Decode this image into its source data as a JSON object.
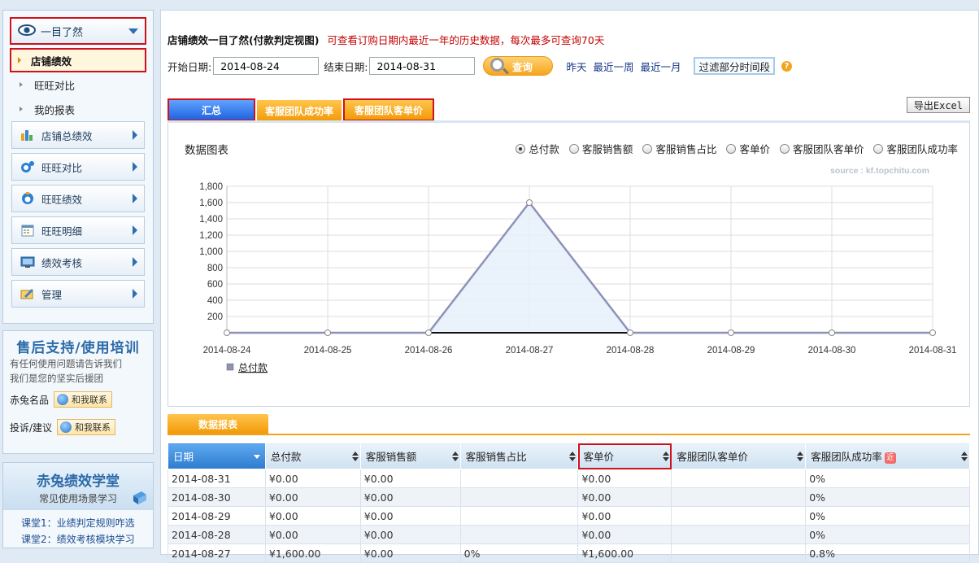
{
  "sidebar": {
    "top_label": "一目了然",
    "active_item": "店铺绩效",
    "subitems": [
      "旺旺对比",
      "我的报表"
    ],
    "menu": [
      {
        "label": "店铺总绩效",
        "icon": "bar-chart-icon"
      },
      {
        "label": "旺旺对比",
        "icon": "wangwang-compare-icon"
      },
      {
        "label": "旺旺绩效",
        "icon": "wangwang-icon"
      },
      {
        "label": "旺旺明细",
        "icon": "calendar-detail-icon"
      },
      {
        "label": "绩效考核",
        "icon": "monitor-icon"
      },
      {
        "label": "管理",
        "icon": "manage-icon"
      }
    ]
  },
  "support": {
    "title": "售后支持/使用培训",
    "line1": "有任何使用问题请告诉我们",
    "line2": "我们是您的坚实后援团",
    "contacts": [
      {
        "label": "赤兔名品",
        "button": "和我联系"
      },
      {
        "label": "投诉/建议",
        "button": "和我联系"
      }
    ]
  },
  "learn": {
    "title": "赤兔绩效学堂",
    "subtitle": "常见使用场景学习",
    "links": [
      "课堂1：业绩判定规则咋选",
      "课堂2：绩效考核模块学习"
    ]
  },
  "header": {
    "title": "店铺绩效一目了然(付款判定视图)",
    "hint": "可查看订购日期内最近一年的历史数据，每次最多可查询70天"
  },
  "filters": {
    "start_label": "开始日期:",
    "start_value": "2014-08-24",
    "end_label": "结束日期:",
    "end_value": "2014-08-31",
    "query_label": "查询",
    "quick": [
      "昨天",
      "最近一周",
      "最近一月"
    ],
    "filter_label": "过滤部分时间段"
  },
  "tabs": [
    {
      "label": "汇总",
      "width": 108
    },
    {
      "label": "客服团队成功率",
      "width": 104
    },
    {
      "label": "客服团队客单价",
      "width": 112
    }
  ],
  "export_label": "导出Excel",
  "chart_panel": {
    "title": "数据图表",
    "radios": [
      "总付款",
      "客服销售额",
      "客服销售占比",
      "客单价",
      "客服团队客单价",
      "客服团队成功率"
    ],
    "selected": "总付款",
    "source": "source : kf.topchitu.com"
  },
  "chart_data": {
    "type": "area",
    "x": [
      "2014-08-24",
      "2014-08-25",
      "2014-08-26",
      "2014-08-27",
      "2014-08-28",
      "2014-08-29",
      "2014-08-30",
      "2014-08-31"
    ],
    "series": [
      {
        "name": "总付款",
        "values": [
          0,
          0,
          0,
          1600,
          0,
          0,
          0,
          0
        ]
      }
    ],
    "ylim": [
      0,
      1800
    ],
    "yticks": [
      "200",
      "400",
      "600",
      "800",
      "1,000",
      "1,200",
      "1,400",
      "1,600",
      "1,800"
    ],
    "grid": true,
    "legend_position": "bottom-left",
    "colors": {
      "line": "#8e92b8",
      "fill": "#e6f1fa",
      "grid": "#dddddd"
    }
  },
  "report_label": "数据报表",
  "table": {
    "columns": [
      "日期",
      "总付款",
      "客服销售额",
      "客服销售占比",
      "客单价",
      "客服团队客单价",
      "客服团队成功率"
    ],
    "badge": "近",
    "rows": [
      [
        "2014-08-31",
        "¥0.00",
        "¥0.00",
        "",
        "¥0.00",
        "",
        "0%"
      ],
      [
        "2014-08-30",
        "¥0.00",
        "¥0.00",
        "",
        "¥0.00",
        "",
        "0%"
      ],
      [
        "2014-08-29",
        "¥0.00",
        "¥0.00",
        "",
        "¥0.00",
        "",
        "0%"
      ],
      [
        "2014-08-28",
        "¥0.00",
        "¥0.00",
        "",
        "¥0.00",
        "",
        "0%"
      ],
      [
        "2014-08-27",
        "¥1,600.00",
        "¥0.00",
        "0%",
        "¥1,600.00",
        "",
        "0.8%"
      ]
    ]
  },
  "colors": {
    "accent_orange": "#f29a08",
    "accent_blue": "#1f63e0",
    "highlight_red": "#d0111b"
  }
}
